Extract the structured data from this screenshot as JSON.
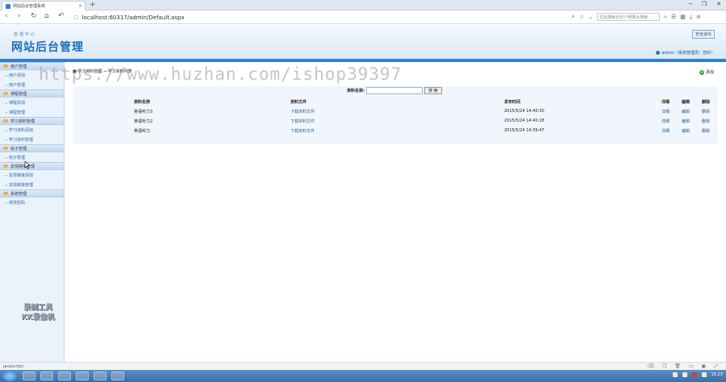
{
  "browser": {
    "tab_title": "网站后台管理系统",
    "new_tab": "+",
    "url": "localhost:60317/admin/Default.aspx",
    "search_placeholder": "在此搜索日记个啊果大搜索",
    "win_min": "─",
    "win_max": "❐",
    "win_close": "✕"
  },
  "header": {
    "subtitle": "管理中心",
    "title": "网站后台管理",
    "logout_label": "安全退出",
    "user_label": "admin（系统管理员）您好！"
  },
  "sidebar": {
    "sections": [
      {
        "title": "用户管理",
        "items": [
          "用户添加",
          "用户管理"
        ]
      },
      {
        "title": "课程管理",
        "items": [
          "课程添加",
          "课程管理"
        ]
      },
      {
        "title": "学习资料管理",
        "items": [
          "学习资料添加",
          "学习资料管理"
        ]
      },
      {
        "title": "帖子管理",
        "items": [
          "帖子管理"
        ]
      },
      {
        "title": "友情链接管理",
        "items": [
          "友情链接添加",
          "友情链接管理"
        ]
      },
      {
        "title": "系统管理",
        "items": [
          "修改密码"
        ]
      }
    ]
  },
  "main": {
    "breadcrumb": "■ 学习资料管理 → 学习资料列表",
    "add_label": "添加",
    "search_label": "资料名称:",
    "search_button": "搜 索",
    "columns": [
      "资料名称",
      "资料文件",
      "发布时间",
      "详细",
      "编辑",
      "删除"
    ],
    "rows": [
      [
        "英语听力3",
        "下载资料文件",
        "2015/5/24 14:40:30",
        "详细",
        "编辑",
        "删除"
      ],
      [
        "英语听力2",
        "下载资料文件",
        "2015/5/24 14:40:18",
        "详细",
        "编辑",
        "删除"
      ],
      [
        "英语听力",
        "下载资料文件",
        "2015/5/24 14:39:47",
        "详细",
        "编辑",
        "删除"
      ]
    ]
  },
  "overlay": {
    "watermark": "https://www.huzhan.com/ishop39397",
    "recorder_line1": "录制工具",
    "recorder_line2": "KK录像机"
  },
  "statusbar": {
    "text": "javascript:"
  },
  "taskbar": {
    "clock": "15:23"
  }
}
